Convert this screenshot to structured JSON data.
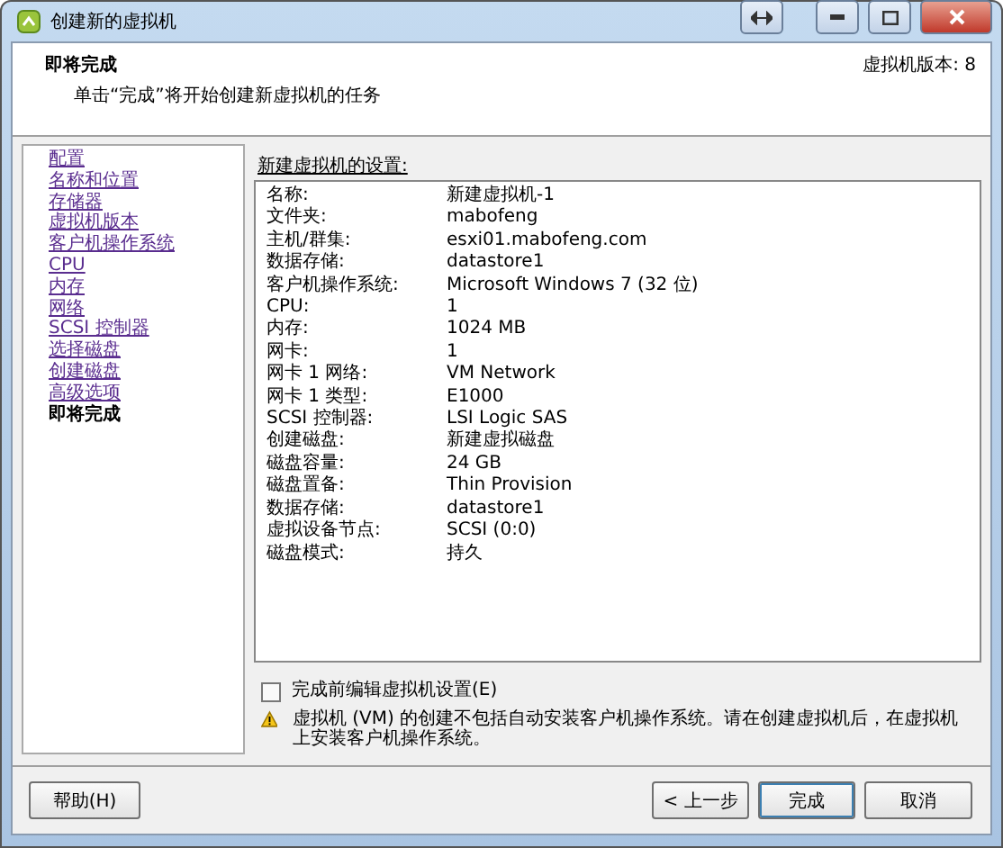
{
  "window": {
    "title": "创建新的虚拟机"
  },
  "header": {
    "title": "即将完成",
    "subtitle": "单击“完成”将开始创建新虚拟机的任务",
    "version": "虚拟机版本: 8"
  },
  "nav": [
    {
      "label": "配置",
      "selected": false
    },
    {
      "label": "名称和位置",
      "selected": false
    },
    {
      "label": "存储器",
      "selected": false
    },
    {
      "label": "虚拟机版本",
      "selected": false
    },
    {
      "label": "客户机操作系统",
      "selected": false
    },
    {
      "label": "CPU",
      "selected": false
    },
    {
      "label": "内存",
      "selected": false
    },
    {
      "label": "网络",
      "selected": false
    },
    {
      "label": "SCSI 控制器",
      "selected": false
    },
    {
      "label": "选择磁盘",
      "selected": false
    },
    {
      "label": "创建磁盘",
      "selected": false
    },
    {
      "label": "高级选项",
      "selected": false
    },
    {
      "label": "即将完成",
      "selected": true
    }
  ],
  "settings": {
    "heading": "新建虚拟机的设置:",
    "rows": [
      {
        "label": "名称:",
        "value": "新建虚拟机-1"
      },
      {
        "label": "文件夹:",
        "value": "mabofeng"
      },
      {
        "label": "主机/群集:",
        "value": "esxi01.mabofeng.com"
      },
      {
        "label": "数据存储:",
        "value": "datastore1"
      },
      {
        "label": "客户机操作系统:",
        "value": "Microsoft Windows 7 (32 位)"
      },
      {
        "label": "CPU:",
        "value": "1"
      },
      {
        "label": "内存:",
        "value": "1024 MB"
      },
      {
        "label": "网卡:",
        "value": "1"
      },
      {
        "label": "网卡 1 网络:",
        "value": "VM Network"
      },
      {
        "label": "网卡 1 类型:",
        "value": "E1000"
      },
      {
        "label": "SCSI 控制器:",
        "value": "LSI Logic SAS"
      },
      {
        "label": "创建磁盘:",
        "value": "新建虚拟磁盘"
      },
      {
        "label": "磁盘容量:",
        "value": "24 GB"
      },
      {
        "label": "磁盘置备:",
        "value": "Thin Provision"
      },
      {
        "label": "数据存储:",
        "value": "datastore1"
      },
      {
        "label": "虚拟设备节点:",
        "value": "SCSI (0:0)"
      },
      {
        "label": "磁盘模式:",
        "value": "持久"
      }
    ]
  },
  "edit_option": {
    "label": "完成前编辑虚拟机设置(E)",
    "checked": false
  },
  "warning": "虚拟机 (VM) 的创建不包括自动安装客户机操作系统。请在创建虚拟机后，在虚拟机上安装客户机操作系统。",
  "buttons": {
    "help": "帮助(H)",
    "back": "< 上一步",
    "finish": "完成",
    "cancel": "取消"
  }
}
